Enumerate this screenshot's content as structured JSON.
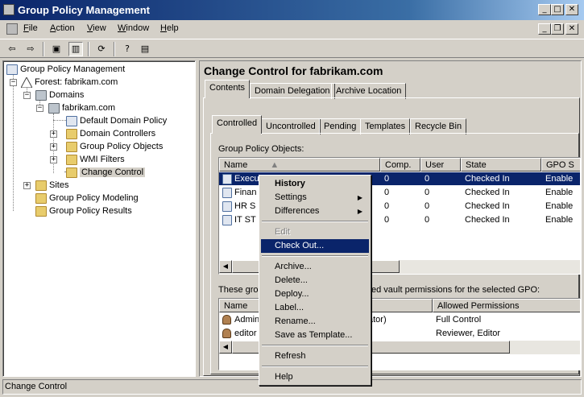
{
  "window": {
    "title": "Group Policy Management"
  },
  "menubar": [
    {
      "label": "File",
      "ul": "F",
      "rest": "ile"
    },
    {
      "label": "Action",
      "ul": "A",
      "rest": "ction"
    },
    {
      "label": "View",
      "ul": "V",
      "rest": "iew"
    },
    {
      "label": "Window",
      "ul": "W",
      "rest": "indow"
    },
    {
      "label": "Help",
      "ul": "H",
      "rest": "elp"
    }
  ],
  "tree": {
    "root": "Group Policy Management",
    "forest": "Forest: fabrikam.com",
    "domains": "Domains",
    "domain": "fabrikam.com",
    "default_policy": "Default Domain Policy",
    "domain_controllers": "Domain Controllers",
    "gpos": "Group Policy Objects",
    "wmi": "WMI Filters",
    "change_control": "Change Control",
    "sites": "Sites",
    "modeling": "Group Policy Modeling",
    "results": "Group Policy Results"
  },
  "right": {
    "title": "Change Control for fabrikam.com",
    "tabs": [
      "Contents",
      "Domain Delegation",
      "Archive Location"
    ],
    "subtabs": [
      "Controlled",
      "Uncontrolled",
      "Pending",
      "Templates",
      "Recycle Bin"
    ],
    "gpo_section_label": "Group Policy Objects:",
    "gpo_columns": [
      "Name",
      "Comp.",
      "User",
      "State",
      "GPO S"
    ],
    "gpo_rows": [
      {
        "name": "Execu",
        "comp": "0",
        "user": "0",
        "state": "Checked In",
        "status": "Enable"
      },
      {
        "name": "Finan",
        "comp": "0",
        "user": "0",
        "state": "Checked In",
        "status": "Enable"
      },
      {
        "name": "HR S",
        "comp": "0",
        "user": "0",
        "state": "Checked In",
        "status": "Enable"
      },
      {
        "name": "IT ST",
        "comp": "0",
        "user": "0",
        "state": "Checked In",
        "status": "Enable"
      }
    ],
    "perm_label_left": "These grou",
    "perm_label_right": "ed vault permissions for the selected GPO:",
    "perm_columns": [
      "Name",
      "Allowed Permissions"
    ],
    "perm_rows": [
      {
        "name": "Admin",
        "name_tail": "ator)",
        "perm": "Full Control"
      },
      {
        "name": "editor",
        "name_tail": "",
        "perm": "Reviewer, Editor"
      }
    ]
  },
  "context_menu": {
    "items": [
      {
        "label": "History",
        "bold": true
      },
      {
        "label": "Settings",
        "submenu": true
      },
      {
        "label": "Differences",
        "submenu": true
      },
      {
        "label": "Edit",
        "disabled": true
      },
      {
        "label": "Check Out...",
        "highlighted": true
      },
      {
        "label": "Archive..."
      },
      {
        "label": "Delete..."
      },
      {
        "label": "Deploy..."
      },
      {
        "label": "Label..."
      },
      {
        "label": "Rename..."
      },
      {
        "label": "Save as Template..."
      },
      {
        "label": "Refresh"
      },
      {
        "label": "Help"
      }
    ]
  },
  "statusbar": {
    "text": "Change Control"
  },
  "colors": {
    "titlebar_start": "#0a246a",
    "selection": "#0a246a",
    "face": "#d4d0c8"
  }
}
